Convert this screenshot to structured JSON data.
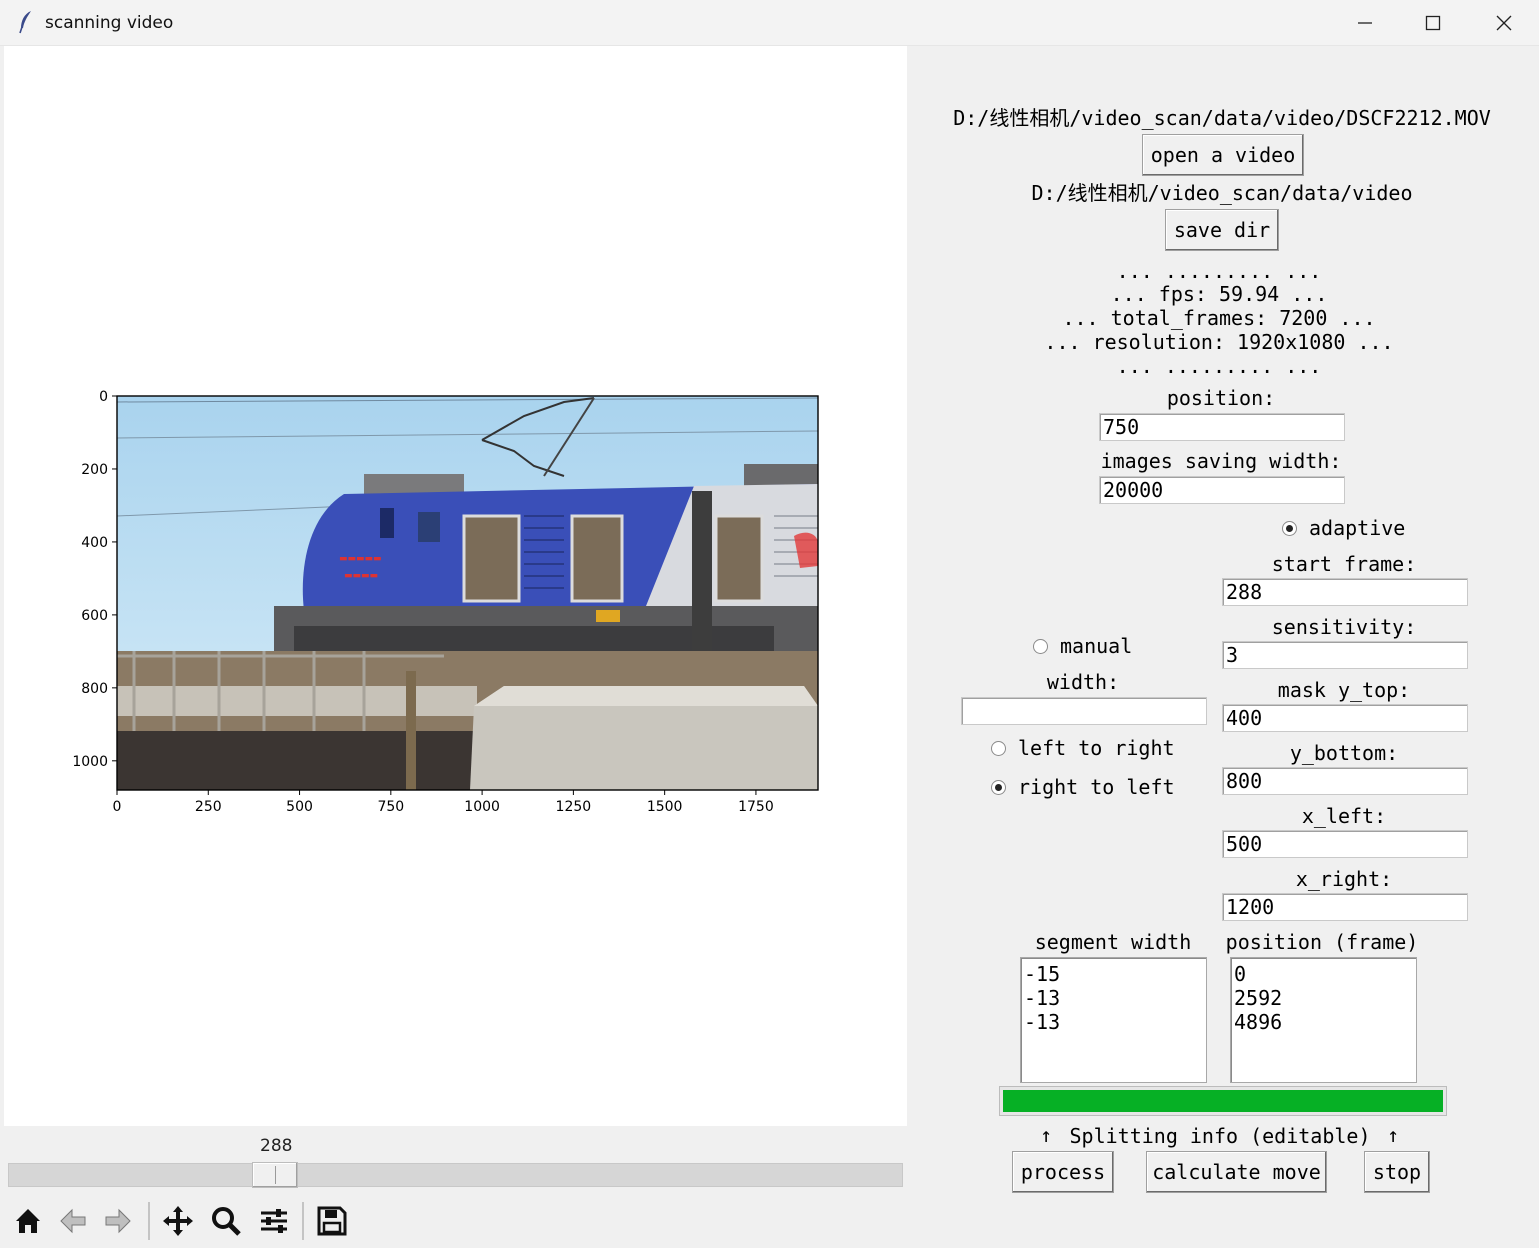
{
  "window": {
    "title": "scanning video",
    "controls": [
      "minimize",
      "maximize",
      "close"
    ]
  },
  "panel": {
    "video_path": "D:/线性相机/video_scan/data/video/DSCF2212.MOV",
    "open_video_label": "open a video",
    "save_dir_path": "D:/线性相机/video_scan/data/video",
    "save_dir_label": "save dir",
    "info_lines": [
      "... ......... ...",
      "... fps: 59.94 ...",
      "... total_frames: 7200 ...",
      "... resolution: 1920x1080 ...",
      "... ......... ..."
    ],
    "position_label": "position:",
    "position_value": "750",
    "saving_width_label": "images saving width:",
    "saving_width_value": "20000",
    "adaptive_label": "adaptive",
    "manual_label": "manual",
    "width_label": "width:",
    "width_value": "",
    "left_to_right_label": "left to right",
    "right_to_left_label": "right to left",
    "start_frame_label": "start frame:",
    "start_frame_value": "288",
    "sensitivity_label": "sensitivity:",
    "sensitivity_value": "3",
    "mask_y_top_label": "mask y_top:",
    "mask_y_top_value": "400",
    "y_bottom_label": "y_bottom:",
    "y_bottom_value": "800",
    "x_left_label": "x_left:",
    "x_left_value": "500",
    "x_right_label": "x_right:",
    "x_right_value": "1200",
    "segment_width_header": "segment width",
    "position_frame_header": "position (frame)",
    "segment_widths": [
      "-15",
      "-13",
      "-13"
    ],
    "positions": [
      "0",
      "2592",
      "4896"
    ],
    "progress_fraction": 1.0,
    "splitting_info_label": "Splitting info (editable)",
    "process_label": "process",
    "calculate_move_label": "calculate move",
    "stop_label": "stop"
  },
  "slider": {
    "value_text": "288"
  },
  "toolbar": {
    "icons": [
      "home-icon",
      "back-icon",
      "forward-icon",
      "pan-icon",
      "zoom-icon",
      "configure-subplots-icon",
      "save-icon"
    ]
  },
  "chart_data": {
    "type": "image",
    "xticks": [
      "0",
      "250",
      "500",
      "750",
      "1000",
      "1250",
      "1500",
      "1750"
    ],
    "yticks": [
      "0",
      "200",
      "400",
      "600",
      "800",
      "1000"
    ],
    "xlim": [
      0,
      1920
    ],
    "ylim": [
      1080,
      0
    ]
  }
}
